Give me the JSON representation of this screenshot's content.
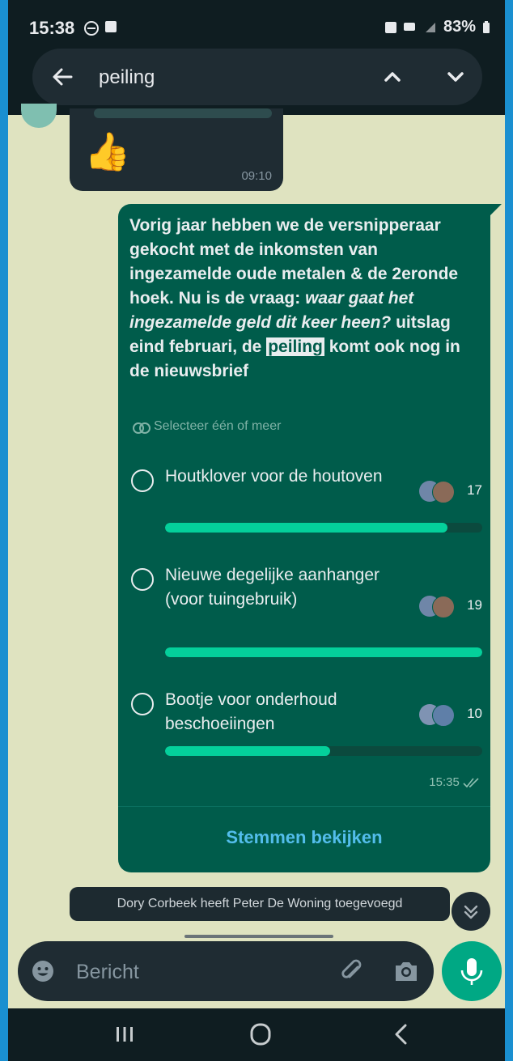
{
  "status_bar": {
    "time": "15:38",
    "battery": "83%"
  },
  "search": {
    "query": "peiling"
  },
  "incoming": {
    "sender": "",
    "emoji": "👍",
    "time": "09:10"
  },
  "poll": {
    "question_parts": [
      "Vorig jaar hebben we de versnipperaar gekocht met de inkomsten van ingezamelde oude metalen & de 2eronde hoek. Nu is de vraag: ",
      "waar gaat het ingezamelde geld dit keer heen?",
      " uitslag eind februari, de ",
      "peiling",
      " komt ook nog in de nieuwsbrief"
    ],
    "select_hint": "Selecteer één of meer",
    "options": [
      {
        "label": "Houtklover voor de houtoven",
        "votes": "17",
        "fraction": 0.89
      },
      {
        "label": "Nieuwe degelijke aanhanger (voor tuingebruik)",
        "votes": "19",
        "fraction": 1.0
      },
      {
        "label": "Bootje voor onderhoud beschoeiingen",
        "votes": "10",
        "fraction": 0.52
      }
    ],
    "time": "15:35",
    "view_votes_label": "Stemmen bekijken"
  },
  "system_notice": "Dory Corbeek heeft Peter De Woning toegevoegd",
  "composer": {
    "placeholder": "Bericht"
  },
  "colors": {
    "accent": "#00a884",
    "bubble_out": "#005c4b",
    "link": "#53bdeb",
    "poll_bar": "#04d09b"
  }
}
